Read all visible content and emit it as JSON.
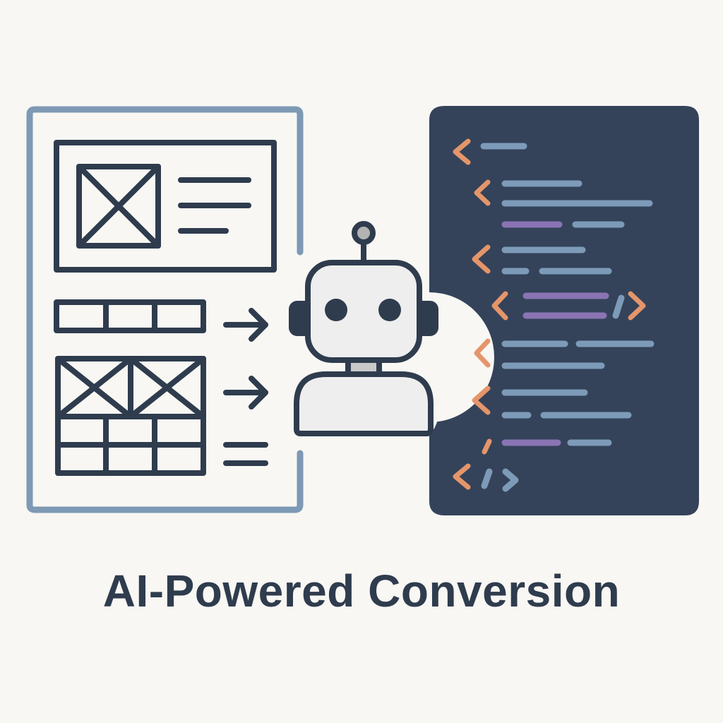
{
  "caption": "AI-Powered Conversion",
  "colors": {
    "background": "#f8f7f3",
    "ink": "#2f3c4e",
    "frame": "#7d99b4",
    "code_panel": "#34435a",
    "code_line": "#7d9bb8",
    "code_keyword": "#8a74b4",
    "bracket": "#e5956a",
    "robot_body": "#eeeeee",
    "robot_neck": "#c9c9c9",
    "antenna_ball": "#b3b3b3"
  },
  "icons": {
    "wireframe": "wireframe-layout-icon",
    "arrow": "right-arrow-icon",
    "robot": "robot-icon",
    "code": "code-editor-icon"
  }
}
